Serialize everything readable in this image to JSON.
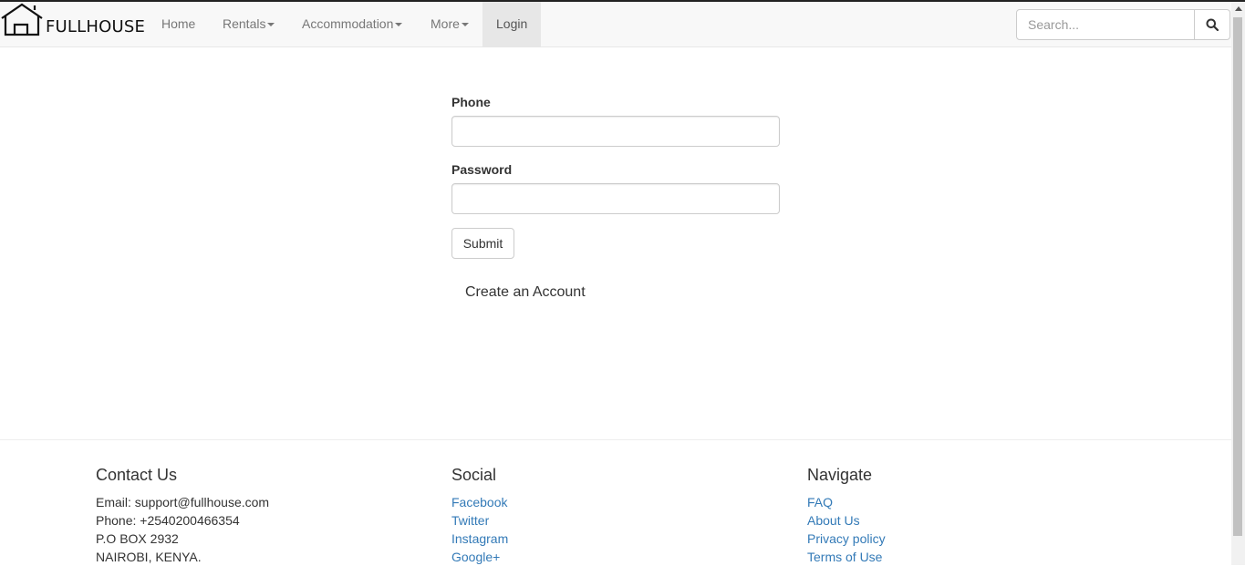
{
  "navbar": {
    "brand": "FULLHOUSE",
    "items": [
      {
        "label": "Home",
        "dropdown": false
      },
      {
        "label": "Rentals",
        "dropdown": true
      },
      {
        "label": "Accommodation",
        "dropdown": true
      },
      {
        "label": "More",
        "dropdown": true
      },
      {
        "label": "Login",
        "dropdown": false,
        "active": true
      }
    ],
    "search": {
      "placeholder": "Search...",
      "value": "",
      "icon": "search-icon"
    }
  },
  "login_form": {
    "phone_label": "Phone",
    "phone_value": "",
    "password_label": "Password",
    "password_value": "",
    "submit_label": "Submit",
    "create_account_label": "Create an Account"
  },
  "footer": {
    "contact": {
      "heading": "Contact Us",
      "lines": [
        "Email: support@fullhouse.com",
        "Phone: +2540200466354",
        "P.O BOX 2932",
        "NAIROBI, KENYA."
      ]
    },
    "social": {
      "heading": "Social",
      "links": [
        "Facebook",
        "Twitter",
        "Instagram",
        "Google+"
      ]
    },
    "navigate": {
      "heading": "Navigate",
      "links": [
        "FAQ",
        "About Us",
        "Privacy policy",
        "Terms of Use"
      ]
    }
  },
  "colors": {
    "navbar_bg": "#f8f8f8",
    "nav_text": "#777777",
    "active_bg": "#e7e7e7",
    "link": "#337ab7",
    "text": "#333333"
  }
}
